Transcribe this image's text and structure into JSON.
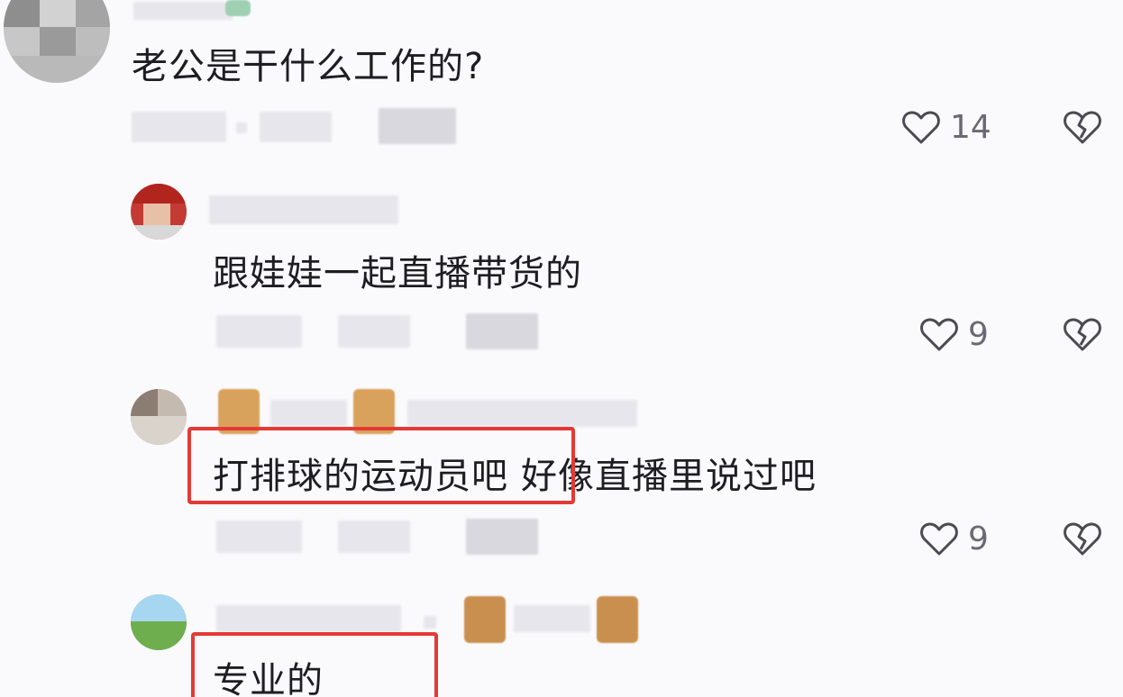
{
  "comments": [
    {
      "text": "老公是干什么工作的?",
      "likes": "14"
    },
    {
      "text": "跟娃娃一起直播带货的",
      "likes": "9"
    },
    {
      "text_highlight": "打排球的运动员吧",
      "text_rest": "好像直播里说过吧",
      "likes": "9"
    },
    {
      "text": "专业的"
    }
  ],
  "icons": {
    "like": "heart-outline-icon",
    "dislike": "broken-heart-icon"
  },
  "colors": {
    "highlight": "#e53935",
    "text": "#1d1d22",
    "muted": "#6a6a74"
  }
}
